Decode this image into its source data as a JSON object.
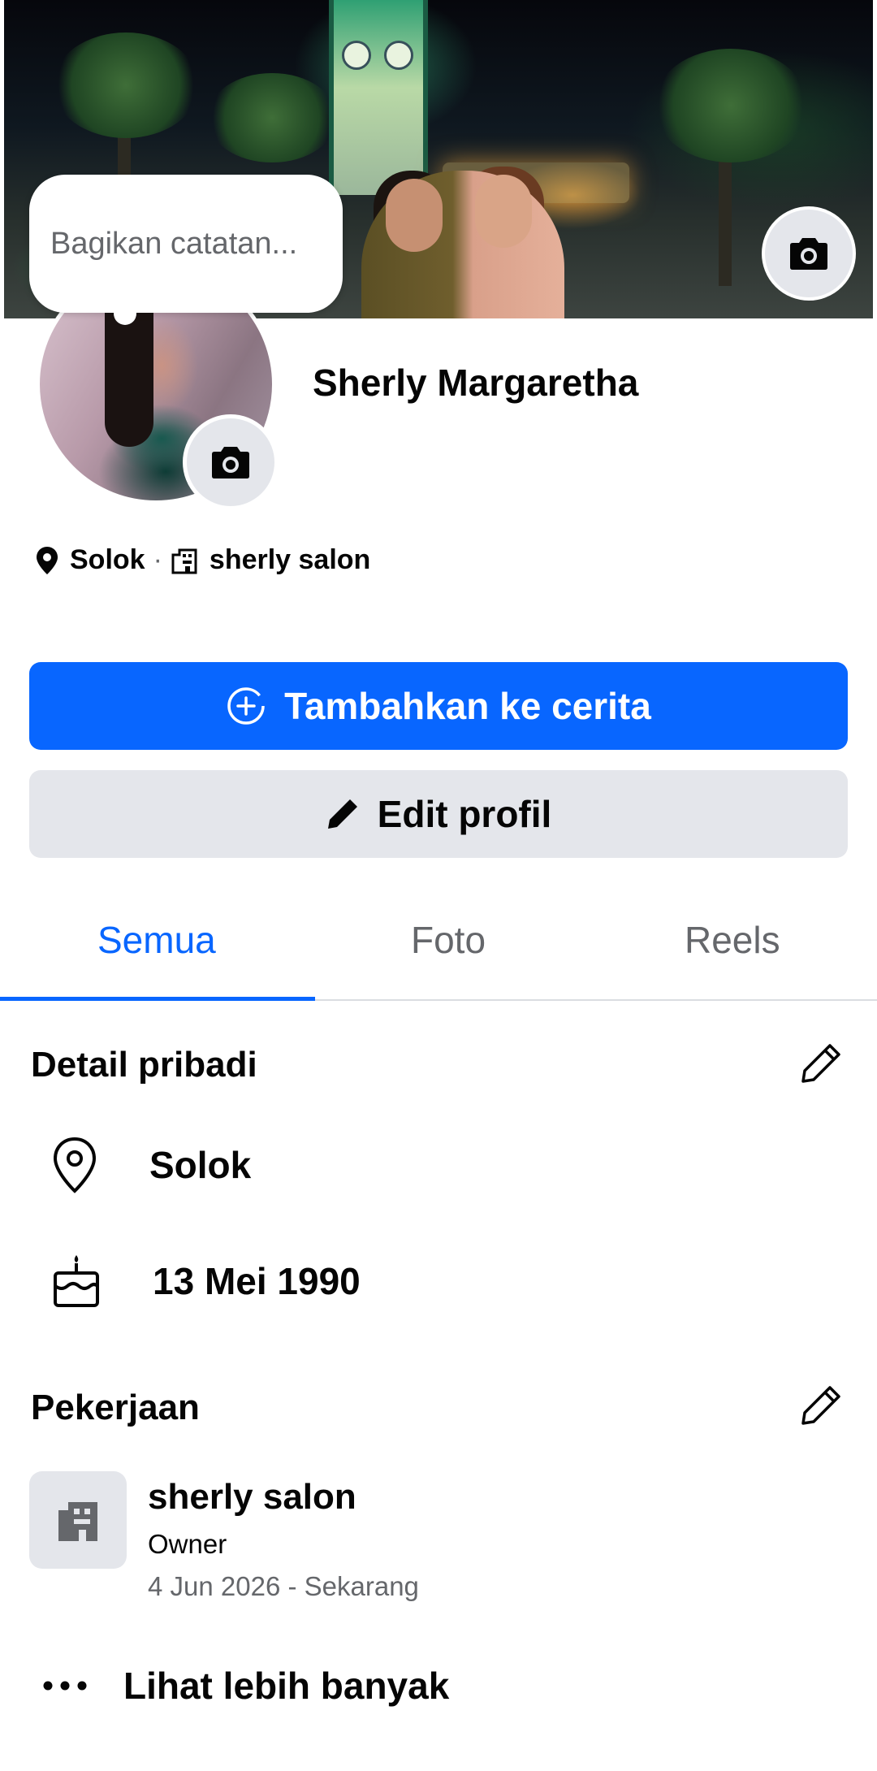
{
  "cover": {
    "camera_icon": "camera-icon"
  },
  "note": {
    "placeholder": "Bagikan catatan..."
  },
  "profile": {
    "name": "Sherly Margaretha",
    "camera_icon": "camera-icon"
  },
  "meta": {
    "location": "Solok",
    "separator": "·",
    "workplace": "sherly salon",
    "location_icon": "location-pin-icon",
    "workplace_icon": "building-icon"
  },
  "actions": {
    "add_to_story": "Tambahkan ke cerita",
    "add_to_story_icon": "plus-circle-icon",
    "edit_profile": "Edit profil",
    "edit_profile_icon": "pencil-icon"
  },
  "tabs": [
    {
      "label": "Semua",
      "active": true
    },
    {
      "label": "Foto",
      "active": false
    },
    {
      "label": "Reels",
      "active": false
    }
  ],
  "personal_details": {
    "title": "Detail pribadi",
    "location": "Solok",
    "birthday": "13 Mei 1990",
    "location_icon": "location-pin-outline-icon",
    "birthday_icon": "cake-icon",
    "edit_icon": "pencil-outline-icon"
  },
  "work": {
    "title": "Pekerjaan",
    "company": "sherly salon",
    "role": "Owner",
    "dates": "4 Jun 2026 - Sekarang",
    "company_icon": "building-icon",
    "edit_icon": "pencil-outline-icon"
  },
  "see_more": {
    "label": "Lihat lebih banyak",
    "icon": "more-dots-icon"
  },
  "colors": {
    "accent": "#0866ff",
    "secondary_button": "#e4e6eb",
    "muted_text": "#65676b"
  }
}
